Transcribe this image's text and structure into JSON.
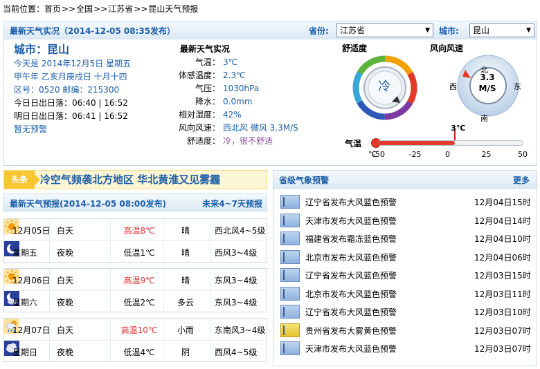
{
  "breadcrumb": {
    "label": "当前位置：",
    "items": [
      "首页",
      "全国",
      "江苏省",
      "昆山天气预报"
    ],
    "separator": ">>"
  },
  "live": {
    "title": "最新天气实况（2014-12-05 08:35发布）",
    "province_label": "省份:",
    "province_value": "江苏省",
    "city_label": "城市:",
    "city_value": "昆山"
  },
  "city_info": {
    "name": "城市：昆山",
    "today": "今天是 2014年12月5日 星期五",
    "lunar": "甲午年 乙亥月庚戌日 十月十四",
    "codes": "区号：0520  邮编：215300",
    "sun_today": "今日日出日落：06:40 | 16:52",
    "sun_tomorrow": "明日日出日落：06:41 | 16:52",
    "alert": "暂无预警"
  },
  "observation": {
    "title": "最新天气实况",
    "rows": [
      {
        "k": "气温：",
        "v": "3℃"
      },
      {
        "k": "体感温度：",
        "v": "2.3℃"
      },
      {
        "k": "气压：",
        "v": "1030hPa"
      },
      {
        "k": "降水：",
        "v": "0.0mm"
      },
      {
        "k": "相对湿度：",
        "v": "42%"
      },
      {
        "k": "风向风速：",
        "v": "西北风 微风 3.3M/S"
      },
      {
        "k": "舒适度：",
        "v": "冷，很不舒适"
      }
    ]
  },
  "comfort": {
    "title": "舒适度",
    "value": "冷"
  },
  "wind": {
    "title": "风向风速",
    "speed": "3.3",
    "unit": "M/S",
    "n": "北",
    "s": "南",
    "e": "东",
    "w": "西"
  },
  "thermo": {
    "label": "气温",
    "current": "3℃",
    "current_value": 3,
    "unit": "℃",
    "ticks": [
      "-50",
      "-25",
      "0",
      "25",
      "50"
    ]
  },
  "headline": {
    "tag": "头条",
    "text": "冷空气频袭北方地区 华北黄淮又见雾霾"
  },
  "forecast": {
    "title": "最新天气预报(2014-12-05 08:00发布)",
    "more": "未来4~7天预报",
    "days": [
      {
        "date": "12月05日",
        "weekday": "星期五",
        "day": {
          "period": "白天",
          "icon": "sun-icon",
          "temp": "高温8℃",
          "weather": "晴",
          "wind": "西北风4~5级"
        },
        "night": {
          "period": "夜晚",
          "icon": "moon-icon",
          "temp": "低温1℃",
          "weather": "晴",
          "wind": "西风3~4级"
        }
      },
      {
        "date": "12月06日",
        "weekday": "星期六",
        "day": {
          "period": "白天",
          "icon": "sun-icon",
          "temp": "高温9℃",
          "weather": "晴",
          "wind": "东风3~4级"
        },
        "night": {
          "period": "夜晚",
          "icon": "moon-cloud-icon",
          "temp": "低温2℃",
          "weather": "多云",
          "wind": "东风3~4级"
        }
      },
      {
        "date": "12月07日",
        "weekday": "星期日",
        "day": {
          "period": "白天",
          "icon": "rain-icon",
          "temp": "高温10℃",
          "weather": "小雨",
          "wind": "东南风3~4级"
        },
        "night": {
          "period": "夜晚",
          "icon": "cloud-icon",
          "temp": "低温4℃",
          "weather": "阴",
          "wind": "西风4~5级"
        }
      }
    ]
  },
  "warnings": {
    "title": "省级气象预警",
    "more": "更多",
    "items": [
      {
        "text": "辽宁省发布大风蓝色预警",
        "time": "12月04日15时",
        "color": "blue"
      },
      {
        "text": "天津市发布大风蓝色预警",
        "time": "12月04日14时",
        "color": "blue"
      },
      {
        "text": "福建省发布霜冻蓝色预警",
        "time": "12月04日10时",
        "color": "blue"
      },
      {
        "text": "北京市发布大风蓝色预警",
        "time": "12月04日06时",
        "color": "blue"
      },
      {
        "text": "辽宁省发布大风蓝色预警",
        "time": "12月03日15时",
        "color": "blue"
      },
      {
        "text": "北京市发布大风蓝色预警",
        "time": "12月03日11时",
        "color": "blue"
      },
      {
        "text": "辽宁省发布大风蓝色预警",
        "time": "12月03日10时",
        "color": "blue"
      },
      {
        "text": "贵州省发布大雾黄色预警",
        "time": "12月03日07时",
        "color": "yellow"
      },
      {
        "text": "天津市发布大风蓝色预警",
        "time": "12月03日07时",
        "color": "blue"
      }
    ]
  }
}
